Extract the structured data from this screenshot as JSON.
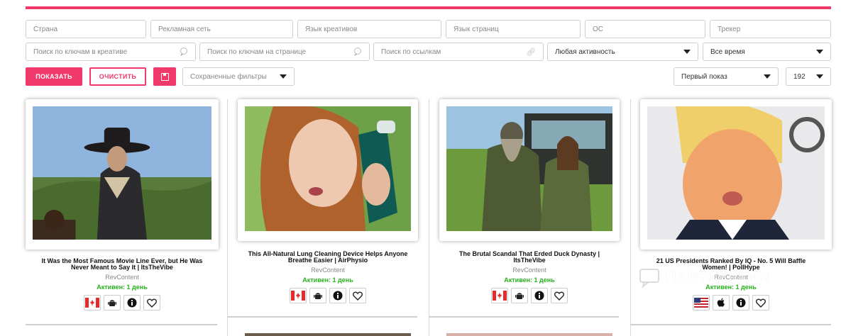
{
  "filters": {
    "country": "Страна",
    "ad_network": "Рекламная сеть",
    "creative_lang": "Язык креативов",
    "page_lang": "Язык страниц",
    "os": "ОС",
    "tracker": "Трекер",
    "search_creative": "Поиск по ключам в креативе",
    "search_page": "Поиск по ключам на странице",
    "search_links": "Поиск по ссылкам",
    "activity": "Любая активность",
    "time": "Все время",
    "saved_filters": "Сохраненные фильтры",
    "sort": "Первый показ",
    "per_page": "192"
  },
  "buttons": {
    "show": "ПОКАЗАТЬ",
    "clear": "ОЧИСТИТЬ"
  },
  "cards": [
    {
      "title": "It Was the Most Famous Movie Line Ever, but He Was Never Meant to Say It | ItsTheVibe",
      "network": "RevContent",
      "status": "Активен: 1 день",
      "flag": "canada",
      "os": "android"
    },
    {
      "title": "This All-Natural Lung Cleaning Device Helps Anyone Breathe Easier | AirPhysio",
      "network": "RevContent",
      "status": "Активен: 1 день",
      "flag": "canada",
      "os": "android"
    },
    {
      "title": "The Brutal Scandal That Erded Duck Dynasty | ItsTheVibe",
      "network": "RevContent",
      "status": "Активен: 1 день",
      "flag": "canada",
      "os": "android"
    },
    {
      "title": "21 US Presidents Ranked By IQ - No. 5 Will Baffle Women! | PollHype",
      "network": "RevContent",
      "status": "Активен: 1 день",
      "flag": "usa",
      "os": "apple"
    }
  ],
  "watermark": "ПАРТНЁРКИН",
  "colors": {
    "accent": "#f0386b",
    "active": "#27b21f"
  }
}
